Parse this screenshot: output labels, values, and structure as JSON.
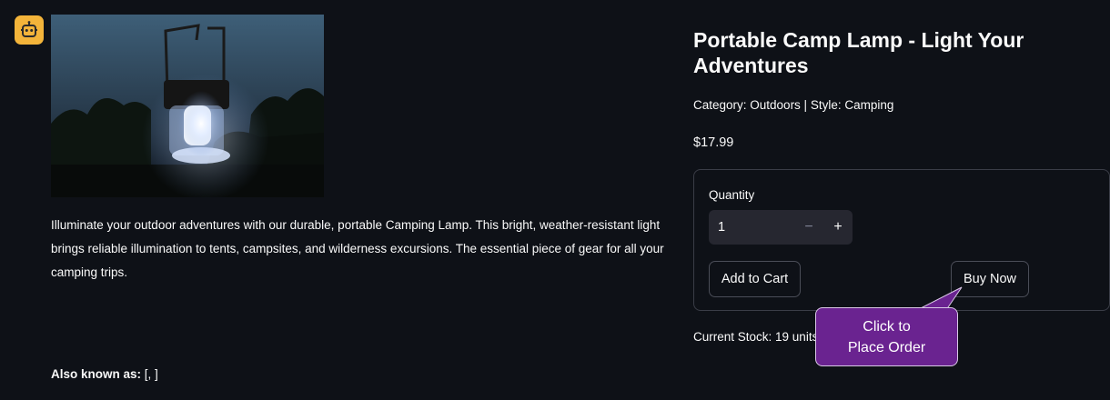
{
  "app": {
    "icon": "robot-icon"
  },
  "product": {
    "image_alt": "Lantern glowing at dusk",
    "description": "Illuminate your outdoor adventures with our durable, portable Camping Lamp. This bright, weather-resistant light brings reliable illumination to tents, campsites, and wilderness excursions. The essential piece of gear for all your camping trips.",
    "aka_label": "Also known as:",
    "aka_value": " [, ]",
    "title": "Portable Camp Lamp - Light Your Adventures",
    "category_line": "Category: Outdoors | Style: Camping",
    "price": "$17.99",
    "stock": "Current Stock: 19 units"
  },
  "order_form": {
    "quantity_label": "Quantity",
    "quantity_value": "1",
    "minus_label": "−",
    "plus_label": "+",
    "add_to_cart_label": "Add to Cart",
    "buy_now_label": "Buy Now"
  },
  "callout": {
    "line1": "Click to",
    "line2": "Place Order"
  },
  "colors": {
    "background": "#0e1117",
    "accent_icon": "#f3b43a",
    "callout": "#6a2390"
  }
}
